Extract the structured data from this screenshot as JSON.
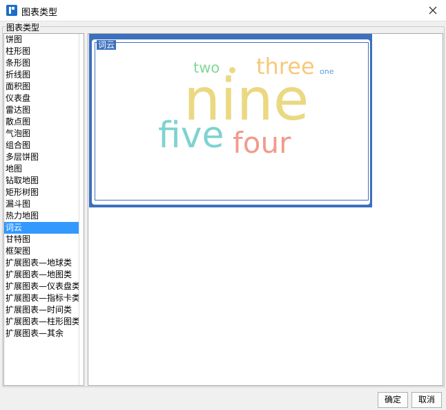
{
  "window": {
    "title": "图表类型",
    "close_glyph": "×"
  },
  "group": {
    "label": "图表类型"
  },
  "chart_types": [
    "饼图",
    "柱形图",
    "条形图",
    "折线图",
    "面积图",
    "仪表盘",
    "雷达图",
    "散点图",
    "气泡图",
    "组合图",
    "多层饼图",
    "地图",
    "钻取地图",
    "矩形树图",
    "漏斗图",
    "热力地图",
    "词云",
    "甘特图",
    "框架图",
    "扩展图表—地球类",
    "扩展图表—地图类",
    "扩展图表—仪表盘类",
    "扩展图表—指标卡类",
    "扩展图表—时间类",
    "扩展图表—柱形图类",
    "扩展图表—其余"
  ],
  "selected_index": 16,
  "preview": {
    "legend": "词云",
    "accent": "#3c6fbd",
    "words": [
      {
        "text": "nine",
        "color": "#ead982"
      },
      {
        "text": "five",
        "color": "#7ed3d1"
      },
      {
        "text": "four",
        "color": "#f29a8d"
      },
      {
        "text": "three",
        "color": "#f8c87a"
      },
      {
        "text": "two",
        "color": "#82d897"
      },
      {
        "text": "one",
        "color": "#5b9be0"
      }
    ],
    "dot_color": "#ead982"
  },
  "buttons": {
    "ok": "确定",
    "cancel": "取消"
  }
}
